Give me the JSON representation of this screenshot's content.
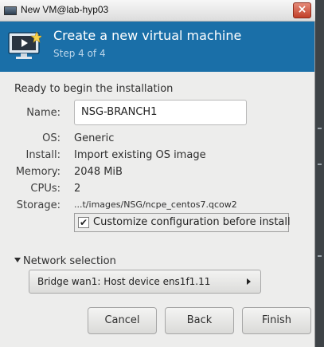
{
  "window": {
    "title": "New VM@lab-hyp03",
    "close_glyph": "×",
    "icon": "virt-manager-icon"
  },
  "header": {
    "title": "Create a new virtual machine",
    "step": "Step 4 of 4",
    "icon": "vm-monitor-icon",
    "bg_color": "#1a6fa8"
  },
  "summary": {
    "heading": "Ready to begin the installation",
    "name_label": "Name:",
    "name_value": "NSG-BRANCH1",
    "os_label": "OS:",
    "os_value": "Generic",
    "install_label": "Install:",
    "install_value": "Import existing OS image",
    "memory_label": "Memory:",
    "memory_value": "2048 MiB",
    "cpus_label": "CPUs:",
    "cpus_value": "2",
    "storage_label": "Storage:",
    "storage_value": "...t/images/NSG/ncpe_centos7.qcow2"
  },
  "customize": {
    "label": "Customize configuration before install",
    "checked": true,
    "check_glyph": "✔"
  },
  "network": {
    "expander_label": "Network selection",
    "selected": "Bridge wan1: Host device ens1f1.11"
  },
  "buttons": {
    "cancel": "Cancel",
    "back": "Back",
    "finish": "Finish"
  }
}
